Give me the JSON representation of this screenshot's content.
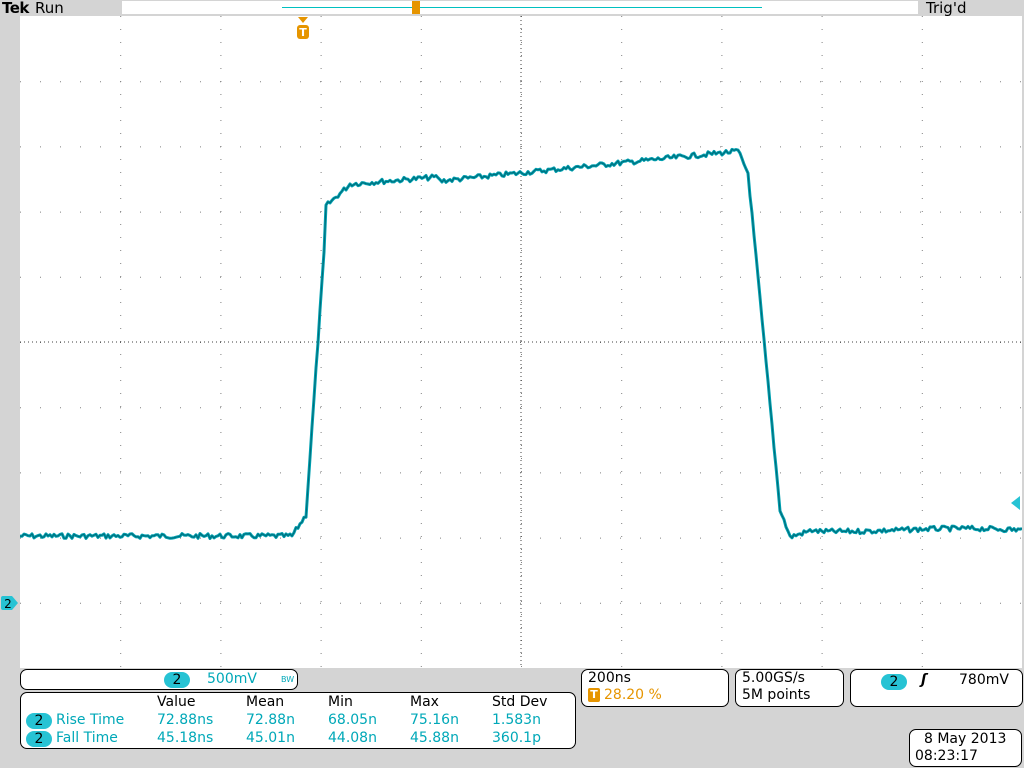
{
  "header": {
    "brand": "Tek",
    "run_state": "Run",
    "trigger_state": "Trig'd"
  },
  "markers": {
    "trigger_position_label": "T",
    "channel2_ground_label": "2"
  },
  "colors": {
    "trace": "#00a0b0",
    "trace_dark": "#006a78",
    "grid_dot": "#808080",
    "accent_orange": "#e69500",
    "channel_badge": "#27c3d4"
  },
  "channel_scale": {
    "channel": "2",
    "scale": "500mV",
    "bw_symbol": "BW"
  },
  "measurements": {
    "headers": [
      "Value",
      "Mean",
      "Min",
      "Max",
      "Std Dev"
    ],
    "rows": [
      {
        "channel": "2",
        "name": "Rise Time",
        "cells": [
          "72.88ns",
          "72.88n",
          "68.05n",
          "75.16n",
          "1.583n"
        ]
      },
      {
        "channel": "2",
        "name": "Fall Time",
        "cells": [
          "45.18ns",
          "45.01n",
          "44.08n",
          "45.88n",
          "360.1p"
        ]
      }
    ]
  },
  "timebase": {
    "time_per_div": "200ns",
    "trigger_marker": "T",
    "trigger_position": "28.20 %"
  },
  "acquisition": {
    "sample_rate": "5.00GS/s",
    "record_length": "5M points"
  },
  "trigger": {
    "channel": "2",
    "slope_symbol": "ʃ",
    "level": "780mV"
  },
  "clock": {
    "date": "8 May 2013",
    "time": "08:23:17"
  }
}
